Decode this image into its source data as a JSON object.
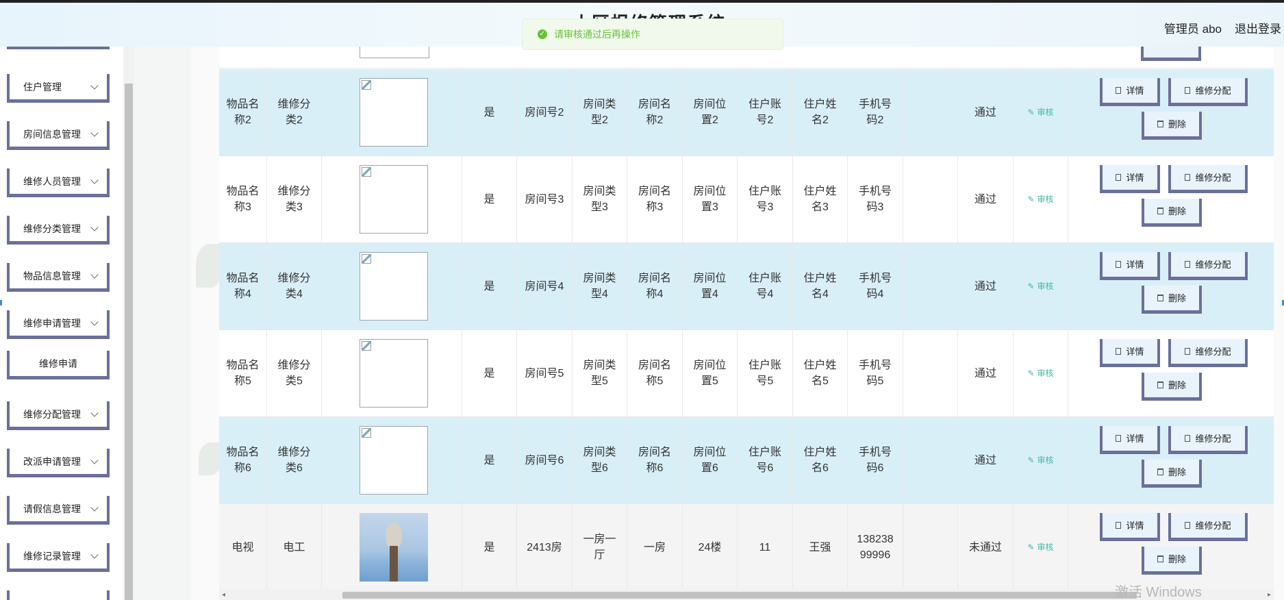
{
  "header": {
    "system_title": "小区报修管理系统",
    "user_label": "管理员 abo",
    "logout_label": "退出登录"
  },
  "toast": {
    "message": "请审核通过后再操作",
    "color": "#67c23a"
  },
  "sidebar": {
    "items": [
      {
        "label": "住户管理"
      },
      {
        "label": "房间信息管理"
      },
      {
        "label": "维修人员管理"
      },
      {
        "label": "维修分类管理"
      },
      {
        "label": "物品信息管理"
      },
      {
        "label": "维修申请管理"
      },
      {
        "label": "维修申请"
      },
      {
        "label": "维修分配管理"
      },
      {
        "label": "改派申请管理"
      },
      {
        "label": "请假信息管理"
      },
      {
        "label": "维修记录管理"
      }
    ]
  },
  "table": {
    "rows": [
      {
        "item": "物品名称2",
        "category": "维修分类2",
        "flag": "是",
        "room_no": "房间号2",
        "room_type": "房间类型2",
        "room_name": "房间名称2",
        "room_pos": "房间位置2",
        "account": "住户账号2",
        "name": "住户姓名2",
        "phone": "手机号码2",
        "status": "通过",
        "audit": "审核",
        "image": "broken"
      },
      {
        "item": "物品名称3",
        "category": "维修分类3",
        "flag": "是",
        "room_no": "房间号3",
        "room_type": "房间类型3",
        "room_name": "房间名称3",
        "room_pos": "房间位置3",
        "account": "住户账号3",
        "name": "住户姓名3",
        "phone": "手机号码3",
        "status": "通过",
        "audit": "审核",
        "image": "broken"
      },
      {
        "item": "物品名称4",
        "category": "维修分类4",
        "flag": "是",
        "room_no": "房间号4",
        "room_type": "房间类型4",
        "room_name": "房间名称4",
        "room_pos": "房间位置4",
        "account": "住户账号4",
        "name": "住户姓名4",
        "phone": "手机号码4",
        "status": "通过",
        "audit": "审核",
        "image": "broken"
      },
      {
        "item": "物品名称5",
        "category": "维修分类5",
        "flag": "是",
        "room_no": "房间号5",
        "room_type": "房间类型5",
        "room_name": "房间名称5",
        "room_pos": "房间位置5",
        "account": "住户账号5",
        "name": "住户姓名5",
        "phone": "手机号码5",
        "status": "通过",
        "audit": "审核",
        "image": "broken"
      },
      {
        "item": "物品名称6",
        "category": "维修分类6",
        "flag": "是",
        "room_no": "房间号6",
        "room_type": "房间类型6",
        "room_name": "房间名称6",
        "room_pos": "房间位置6",
        "account": "住户账号6",
        "name": "住户姓名6",
        "phone": "手机号码6",
        "status": "通过",
        "audit": "审核",
        "image": "broken"
      },
      {
        "item": "电视",
        "category": "电工",
        "flag": "是",
        "room_no": "2413房",
        "room_type": "一房一厅",
        "room_name": "一房",
        "room_pos": "24楼",
        "account": "11",
        "name": "王强",
        "phone": "13823899996",
        "status": "未通过",
        "audit": "审核",
        "image": "photo"
      }
    ],
    "actions": {
      "detail": "详情",
      "assign": "维修分配",
      "delete": "删除"
    }
  },
  "watermark": "激活 Windows"
}
